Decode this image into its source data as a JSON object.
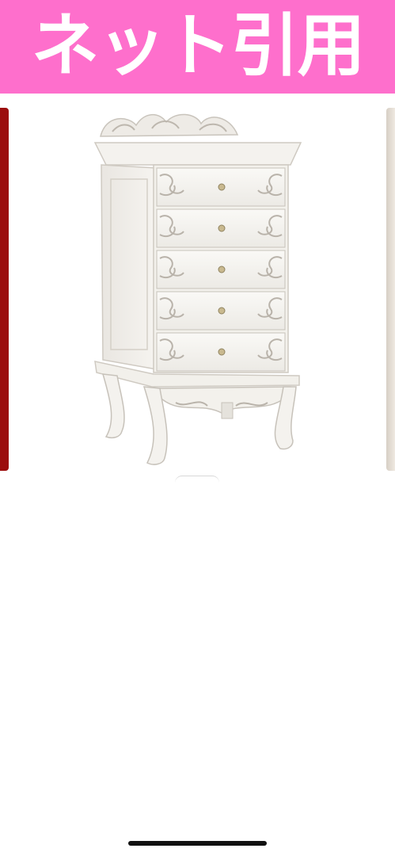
{
  "banner": {
    "text": "ネット引用",
    "background": "#fe6fcc",
    "text_color": "#ffffff"
  },
  "carousel": {
    "current_image": "white-carved-5-drawer-chest-photo",
    "previous_slide_color": "#9b0d0d",
    "next_slide_color": "#e6ddd2"
  },
  "icons": {
    "page_indicator": "page-indicator-arc-icon",
    "home_indicator": "home-indicator-bar"
  }
}
